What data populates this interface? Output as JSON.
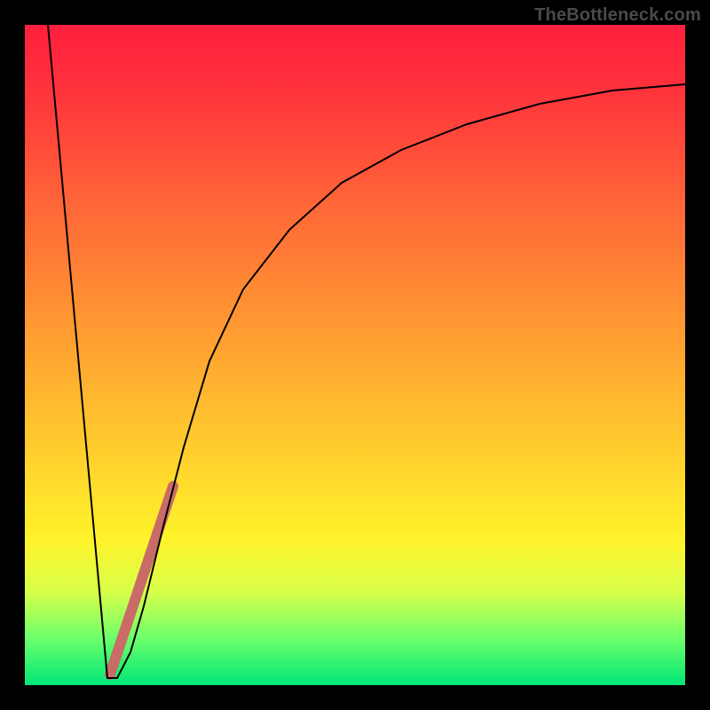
{
  "watermark": {
    "text": "TheBottleneck.com"
  },
  "chart_data": {
    "type": "line",
    "title": "",
    "xlabel": "",
    "ylabel": "",
    "xlim": [
      0,
      100
    ],
    "ylim": [
      0,
      100
    ],
    "grid": false,
    "series": [
      {
        "name": "bottleneck-curve",
        "color": "#000000",
        "stroke_width": 1.5,
        "points": [
          {
            "x": 3.5,
            "y": 100
          },
          {
            "x": 12.5,
            "y": 1
          },
          {
            "x": 14,
            "y": 1
          },
          {
            "x": 16,
            "y": 5
          },
          {
            "x": 18,
            "y": 12
          },
          {
            "x": 21,
            "y": 24
          },
          {
            "x": 24,
            "y": 36
          },
          {
            "x": 28,
            "y": 49
          },
          {
            "x": 33,
            "y": 60
          },
          {
            "x": 40,
            "y": 69
          },
          {
            "x": 48,
            "y": 76
          },
          {
            "x": 57,
            "y": 81
          },
          {
            "x": 67,
            "y": 85
          },
          {
            "x": 78,
            "y": 88
          },
          {
            "x": 89,
            "y": 90
          },
          {
            "x": 100,
            "y": 91
          }
        ]
      },
      {
        "name": "highlight-segment",
        "color": "#c96b66",
        "stroke_width": 12,
        "linecap": "round",
        "points": [
          {
            "x": 13,
            "y": 1.5
          },
          {
            "x": 22.5,
            "y": 30
          }
        ]
      }
    ],
    "background_gradient": [
      "#ff1f3d",
      "#fff32a",
      "#00e676"
    ]
  }
}
